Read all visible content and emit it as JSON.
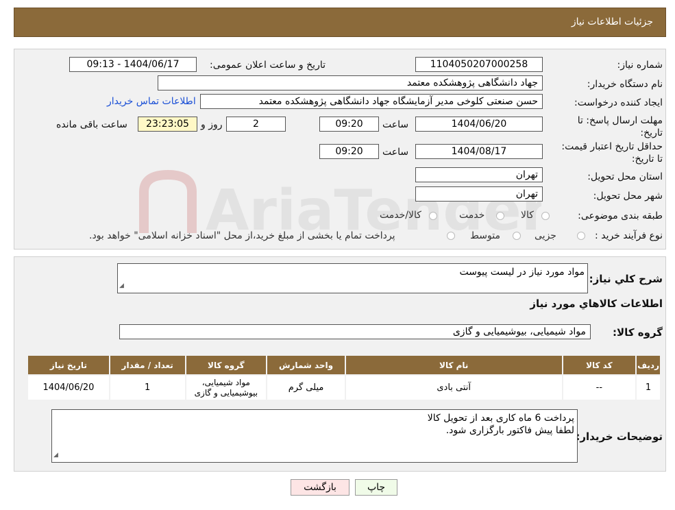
{
  "header": {
    "title": "جزئیات اطلاعات نیاز"
  },
  "form": {
    "need_number_label": "شماره نیاز:",
    "need_number": "1104050207000258",
    "announce_label": "تاریخ و ساعت اعلان عمومی:",
    "announce_value": "1404/06/17 - 09:13",
    "buyer_org_label": "نام دستگاه خریدار:",
    "buyer_org": "جهاد دانشگاهی پژوهشکده معتمد",
    "creator_label": "ایجاد کننده درخواست:",
    "creator": "حسن صنعتی کلوخی مدیر آزمایشگاه جهاد دانشگاهی پژوهشکده معتمد",
    "contact_link": "اطلاعات تماس خریدار",
    "deadline_label": "مهلت ارسال پاسخ: تا تاریخ:",
    "deadline_date": "1404/06/20",
    "time_label": "ساعت",
    "deadline_time": "09:20",
    "days_value": "2",
    "days_label": "روز و",
    "remaining_time": "23:23:05",
    "remaining_label": "ساعت باقی مانده",
    "validity_label": "حداقل تاریخ اعتبار قیمت: تا تاریخ:",
    "validity_date": "1404/08/17",
    "validity_time": "09:20",
    "province_label": "استان محل تحویل:",
    "province": "تهران",
    "city_label": "شهر محل تحویل:",
    "city": "تهران",
    "category_label": "طبقه بندی موضوعی:",
    "category_options": [
      "کالا",
      "خدمت",
      "کالا/خدمت"
    ],
    "process_label": "نوع فرآیند خرید :",
    "process_options": [
      "جزیی",
      "متوسط"
    ],
    "process_note": "پرداخت تمام یا بخشی از مبلغ خرید،از محل \"اسناد خزانه اسلامی\" خواهد بود."
  },
  "details": {
    "summary_label": "شرح کلي نیاز:",
    "summary": "مواد مورد نیاز در لیست پیوست",
    "goods_info_title": "اطلاعات کالاهاي مورد نیاز",
    "goods_group_label": "گروه کالا:",
    "goods_group": "مواد شیمیایی، بیوشیمیایی و  گازی",
    "table": {
      "headers": [
        "ردیف",
        "کد کالا",
        "نام کالا",
        "واحد شمارش",
        "گروه کالا",
        "تعداد / مقدار",
        "تاریخ نیاز"
      ],
      "rows": [
        [
          "1",
          "--",
          "آنتی بادی",
          "میلی گرم",
          "مواد شیمیایی، بیوشیمیایی و گازی",
          "1",
          "1404/06/20"
        ]
      ]
    },
    "buyer_notes_label": "توضیحات خریدار:",
    "buyer_notes_line1": "پرداخت 6 ماه کاری بعد از تحویل کالا",
    "buyer_notes_line2": "لطفا پیش فاکتور بارگزاری شود."
  },
  "buttons": {
    "print": "چاپ",
    "back": "بازگشت"
  },
  "colors": {
    "header": "#8b6a3a",
    "panel": "#f1f1f1",
    "link": "#1a4fd6",
    "remaining_bg": "#fff8c6"
  },
  "watermark_text": "AriaTender.neT"
}
